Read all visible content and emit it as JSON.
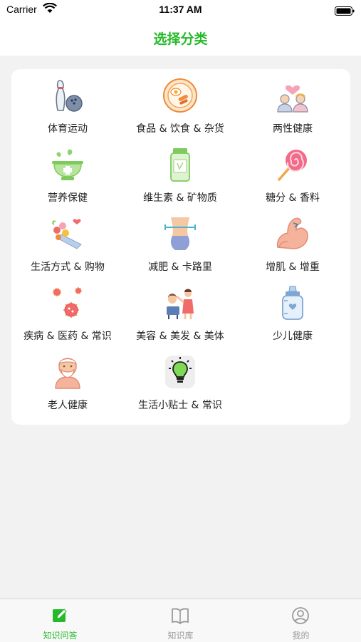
{
  "status_bar": {
    "carrier": "Carrier",
    "time": "11:37 AM"
  },
  "nav": {
    "title": "选择分类"
  },
  "categories": [
    {
      "label": "体育运动",
      "icon": "bowling-icon"
    },
    {
      "label": "食品 & 饮食 & 杂货",
      "icon": "breakfast-plate-icon"
    },
    {
      "label": "两性健康",
      "icon": "couple-heart-icon"
    },
    {
      "label": "营养保健",
      "icon": "herbal-mortar-icon"
    },
    {
      "label": "维生素 & 矿物质",
      "icon": "vitamin-bottle-icon"
    },
    {
      "label": "糖分 & 香料",
      "icon": "lollipop-icon"
    },
    {
      "label": "生活方式 & 购物",
      "icon": "flower-bouquet-icon"
    },
    {
      "label": "减肥 & 卡路里",
      "icon": "waist-measure-icon"
    },
    {
      "label": "增肌 & 增重",
      "icon": "flexed-arm-icon"
    },
    {
      "label": "疾病 & 医药 & 常识",
      "icon": "virus-icon"
    },
    {
      "label": "美容 & 美发 & 美体",
      "icon": "hair-salon-icon"
    },
    {
      "label": "少儿健康",
      "icon": "baby-bottle-icon"
    },
    {
      "label": "老人健康",
      "icon": "old-man-icon"
    },
    {
      "label": "生活小贴士 & 常识",
      "icon": "lightbulb-icon"
    }
  ],
  "tabs": [
    {
      "label": "知识问答",
      "icon": "edit-note-icon",
      "active": true
    },
    {
      "label": "知识库",
      "icon": "open-book-icon",
      "active": false
    },
    {
      "label": "我的",
      "icon": "user-profile-icon",
      "active": false
    }
  ],
  "colors": {
    "accent": "#27b92b",
    "background": "#f2f2f2",
    "card": "#ffffff"
  }
}
